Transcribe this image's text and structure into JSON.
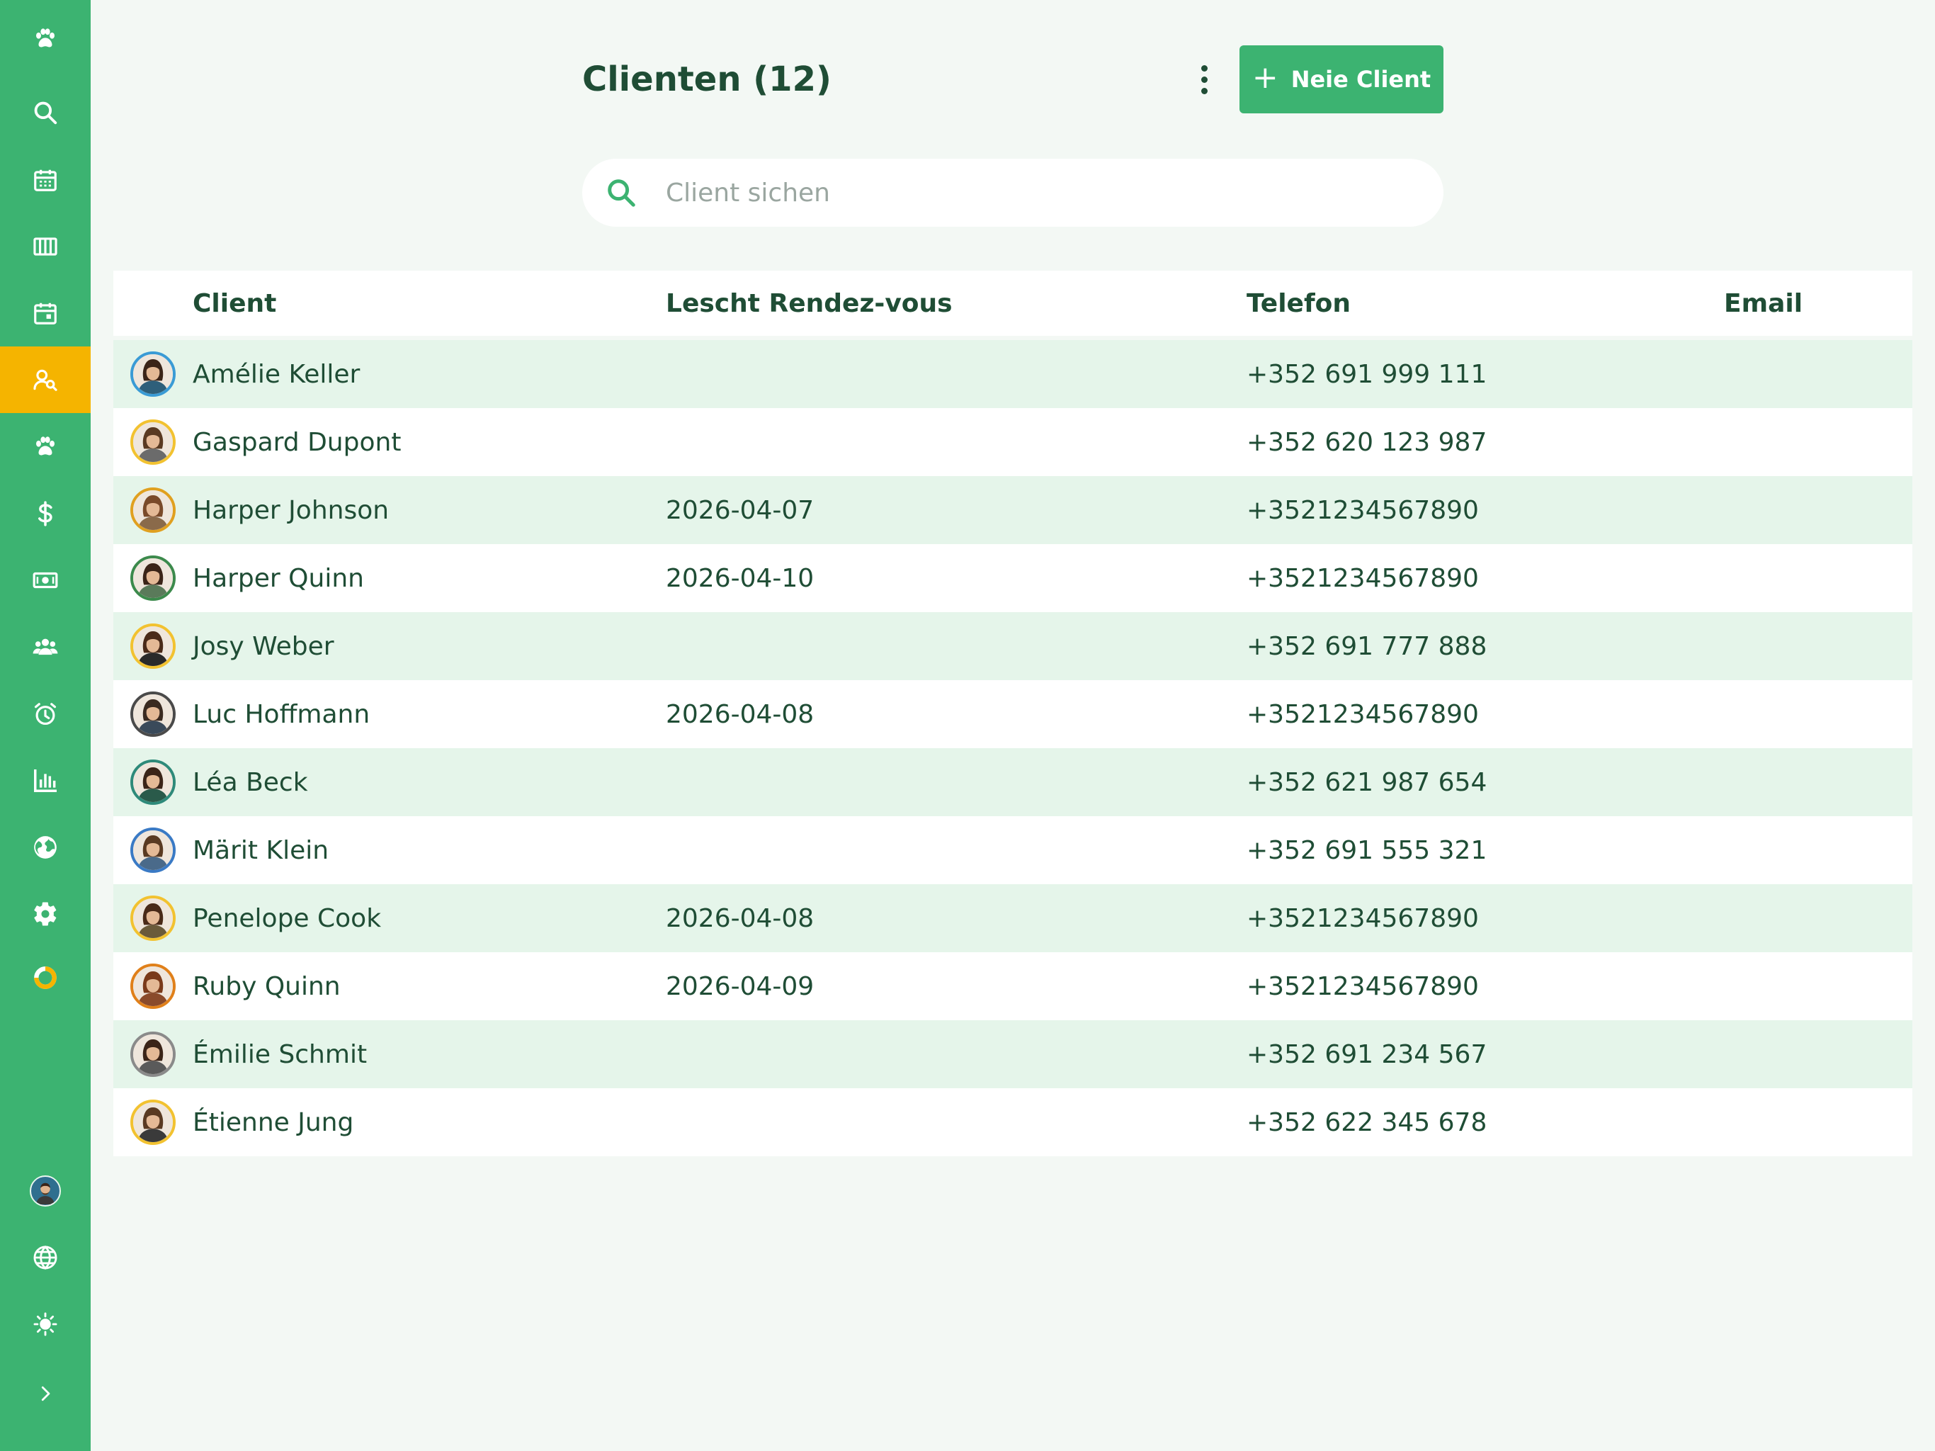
{
  "header": {
    "title": "Clienten (12)",
    "new_client_label": "Neie Client",
    "new_client_icon": "plus-icon",
    "more_icon": "more-vertical-icon"
  },
  "search": {
    "placeholder": "Client sichen",
    "value": ""
  },
  "sidebar": {
    "items": [
      {
        "icon": "paw-logo-icon"
      },
      {
        "icon": "search-icon"
      },
      {
        "icon": "calendar-icon"
      },
      {
        "icon": "columns-icon"
      },
      {
        "icon": "calendar-day-icon"
      },
      {
        "icon": "client-search-icon",
        "active": true
      },
      {
        "icon": "paw-icon"
      },
      {
        "icon": "dollar-icon"
      },
      {
        "icon": "banknote-icon"
      },
      {
        "icon": "team-icon"
      },
      {
        "icon": "alarm-icon"
      },
      {
        "icon": "bar-chart-icon"
      },
      {
        "icon": "globe-icon"
      },
      {
        "icon": "settings-icon"
      },
      {
        "icon": "donut-progress-icon"
      }
    ],
    "bottom": [
      {
        "icon": "user-avatar"
      },
      {
        "icon": "language-icon"
      },
      {
        "icon": "theme-sun-icon"
      },
      {
        "icon": "chevron-right-icon"
      }
    ]
  },
  "table": {
    "columns": [
      "Client",
      "Lescht Rendez-vous",
      "Telefon",
      "Email"
    ],
    "rows": [
      {
        "name": "Amélie Keller",
        "last": "",
        "phone": "+352 691 999 111",
        "email": "",
        "ring": "#3a9bd5",
        "hair": "#3b2418",
        "shirt": "#2e5f7a"
      },
      {
        "name": "Gaspard Dupont",
        "last": "",
        "phone": "+352 620 123 987",
        "email": "",
        "ring": "#f2c230",
        "hair": "#5a3a22",
        "shirt": "#6b6b6b"
      },
      {
        "name": "Harper Johnson",
        "last": "2026-04-07",
        "phone": "+3521234567890",
        "email": "",
        "ring": "#e0a020",
        "hair": "#7a4a2a",
        "shirt": "#8a6a4a"
      },
      {
        "name": "Harper Quinn",
        "last": "2026-04-10",
        "phone": "+3521234567890",
        "email": "",
        "ring": "#3c8a4c",
        "hair": "#3b2418",
        "shirt": "#5a7a5a"
      },
      {
        "name": "Josy Weber",
        "last": "",
        "phone": "+352 691 777 888",
        "email": "",
        "ring": "#f2c230",
        "hair": "#4a2a18",
        "shirt": "#2a2a2a"
      },
      {
        "name": "Luc Hoffmann",
        "last": "2026-04-08",
        "phone": "+3521234567890",
        "email": "",
        "ring": "#4a4a4a",
        "hair": "#3a2a20",
        "shirt": "#3a4a5a"
      },
      {
        "name": "Léa Beck",
        "last": "",
        "phone": "+352 621 987 654",
        "email": "",
        "ring": "#2e8a7a",
        "hair": "#3b2418",
        "shirt": "#2a5a4a"
      },
      {
        "name": "Märit Klein",
        "last": "",
        "phone": "+352 691 555 321",
        "email": "",
        "ring": "#3a7ac5",
        "hair": "#5a3a22",
        "shirt": "#4a6a8a"
      },
      {
        "name": "Penelope Cook",
        "last": "2026-04-08",
        "phone": "+3521234567890",
        "email": "",
        "ring": "#f2c230",
        "hair": "#4a2a18",
        "shirt": "#6a5a3a"
      },
      {
        "name": "Ruby Quinn",
        "last": "2026-04-09",
        "phone": "+3521234567890",
        "email": "",
        "ring": "#e0801a",
        "hair": "#7a3a1a",
        "shirt": "#8a4a2a"
      },
      {
        "name": "Émilie Schmit",
        "last": "",
        "phone": "+352 691 234 567",
        "email": "",
        "ring": "#8a8a8a",
        "hair": "#3b2418",
        "shirt": "#5a5a5a"
      },
      {
        "name": "Étienne Jung",
        "last": "",
        "phone": "+352 622 345 678",
        "email": "",
        "ring": "#f2c230",
        "hair": "#5a3a22",
        "shirt": "#3a3a3a"
      }
    ]
  },
  "colors": {
    "primary": "#3cb371",
    "active": "#f5b400",
    "text": "#1f4d35",
    "row_alt": "#e5f5ea",
    "background": "#f3f8f4"
  }
}
